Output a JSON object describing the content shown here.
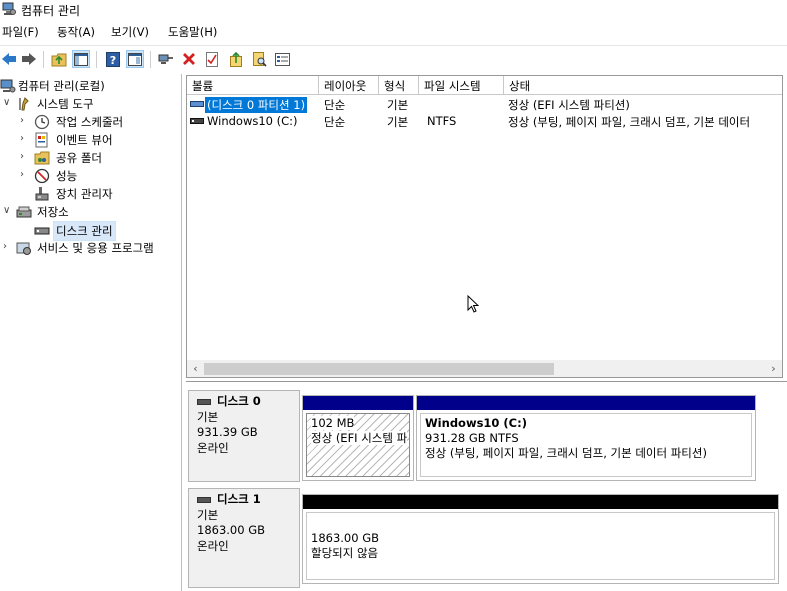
{
  "window": {
    "title": "컴퓨터 관리"
  },
  "menu": [
    "파일(F)",
    "동작(A)",
    "보기(V)",
    "도움말(H)"
  ],
  "toolbar": [
    "back-icon",
    "forward-icon",
    "up-folder-icon",
    "show-tree-icon",
    "help-icon",
    "console-view-icon",
    "connect-icon",
    "delete-icon",
    "properties-check-icon",
    "export-icon",
    "find-icon",
    "list-icon"
  ],
  "tree": {
    "root": "컴퓨터 관리(로컬)",
    "system_tools": "시스템 도구",
    "task_scheduler": "작업 스케줄러",
    "event_viewer": "이벤트 뷰어",
    "shared_folders": "공유 폴더",
    "performance": "성능",
    "device_manager": "장치 관리자",
    "storage": "저장소",
    "disk_management": "디스크 관리",
    "services": "서비스 및 응용 프로그램"
  },
  "volume_list": {
    "columns": [
      "볼륨",
      "레이아웃",
      "형식",
      "파일 시스템",
      "상태"
    ],
    "rows": [
      {
        "volume": "(디스크 0 파티션 1)",
        "layout": "단순",
        "type": "기본",
        "fs": "",
        "status": "정상 (EFI 시스템 파티션)"
      },
      {
        "volume": "Windows10 (C:)",
        "layout": "단순",
        "type": "기본",
        "fs": "NTFS",
        "status": "정상 (부팅, 페이지 파일, 크래시 덤프, 기본 데이터"
      }
    ]
  },
  "disks": [
    {
      "name": "디스크 0",
      "kind": "기본",
      "size": "931.39 GB",
      "state": "온라인",
      "partitions": [
        {
          "title": "",
          "size": "102 MB",
          "status": "정상 (EFI 시스템 파",
          "bar_color": "#00008b"
        },
        {
          "title": "Windows10  (C:)",
          "size": "931.28 GB NTFS",
          "status": "정상 (부팅, 페이지 파일, 크래시 덤프, 기본 데이터 파티션)",
          "bar_color": "#00008b"
        }
      ]
    },
    {
      "name": "디스크 1",
      "kind": "기본",
      "size": "1863.00 GB",
      "state": "온라인",
      "partitions": [
        {
          "size": "1863.00 GB",
          "status": "할당되지 않음",
          "bar_color": "#000000"
        }
      ]
    }
  ]
}
